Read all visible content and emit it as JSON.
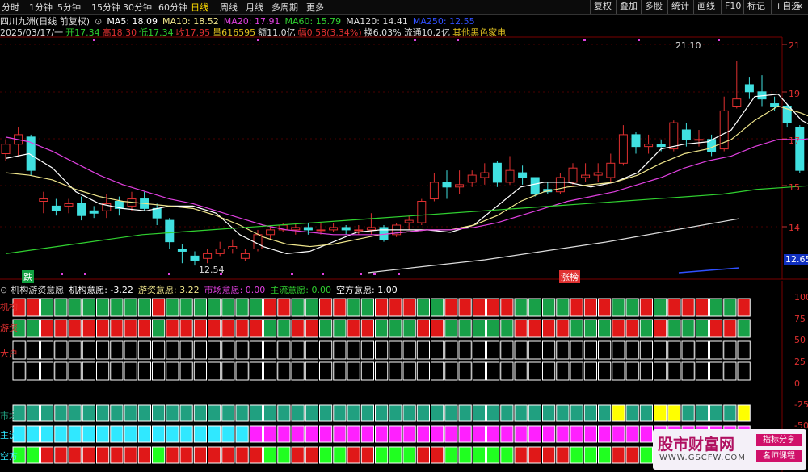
{
  "toolbar": {
    "periods": [
      "分时",
      "1分钟",
      "5分钟",
      "15分钟",
      "30分钟",
      "60分钟",
      "日线",
      "周线",
      "月线",
      "多周期",
      "更多"
    ],
    "active_period": "日线",
    "right_buttons": [
      "复权",
      "叠加",
      "多股",
      "统计",
      "画线",
      "F10",
      "标记",
      "+自选"
    ],
    "close_glyph": "×"
  },
  "info": {
    "stock_name": "四川九洲(日线 前复权)",
    "ma": [
      {
        "label": "MA5: 18.09",
        "color": "#ffffff"
      },
      {
        "label": "MA10: 18.52",
        "color": "#f0e68c"
      },
      {
        "label": "MA20: 17.91",
        "color": "#e040e0"
      },
      {
        "label": "MA60: 15.79",
        "color": "#30d030"
      },
      {
        "label": "MA120: 14.41",
        "color": "#dddddd"
      },
      {
        "label": "MA250: 12.55",
        "color": "#3050ff"
      }
    ],
    "quote": [
      {
        "label": "2025/03/17/一",
        "color": "#dddddd"
      },
      {
        "label": "开17.34",
        "color": "#30d030"
      },
      {
        "label": "高18.30",
        "color": "#e03030"
      },
      {
        "label": "低17.34",
        "color": "#30d030"
      },
      {
        "label": "收17.95",
        "color": "#e03030"
      },
      {
        "label": "量616595",
        "color": "#e0c020"
      },
      {
        "label": "额11.0亿",
        "color": "#dddddd"
      },
      {
        "label": "幅0.58(3.34%)",
        "color": "#e03030"
      },
      {
        "label": "换6.03%",
        "color": "#dddddd"
      },
      {
        "label": "流通10.2亿",
        "color": "#dddddd"
      },
      {
        "label": "其他黑色家电",
        "color": "#e0c020"
      }
    ]
  },
  "main_axis": [
    "21",
    "19",
    "17",
    "15",
    "14",
    "12.65"
  ],
  "annotations": {
    "high": "21.10",
    "low": "12.54",
    "fall_tag": "跌",
    "rise_tag": "涨榜"
  },
  "indicator": {
    "title_parts": [
      {
        "label": "机构游资意愿",
        "color": "#dddddd"
      },
      {
        "label": "机构意愿: -3.22",
        "color": "#ffffff"
      },
      {
        "label": "游资意愿: 3.22",
        "color": "#f0e68c"
      },
      {
        "label": "市场意愿: 0.00",
        "color": "#e040e0"
      },
      {
        "label": "主流意愿: 0.00",
        "color": "#30d030"
      },
      {
        "label": "空方意愿: 1.00",
        "color": "#ffffff"
      }
    ],
    "axis": [
      "100",
      "75",
      "50",
      "25",
      "0",
      "-25",
      "-50"
    ],
    "row_labels": [
      "机构",
      "游资",
      "大户",
      "市场",
      "主流",
      "空方"
    ]
  },
  "watermark": {
    "main": "股市财富网",
    "url": "WWW.GSCFW.COM",
    "tag1": "指标分享",
    "tag2": "名师课程"
  },
  "colors": {
    "up": "#e03030",
    "down": "#40e0e0",
    "cell_red": "#e01818",
    "cell_green": "#18a048",
    "teal": "#20a080",
    "yellow": "#ffff00",
    "cyan": "#30e8ff",
    "magenta": "#ff20ff",
    "lime": "#20ff20"
  }
}
